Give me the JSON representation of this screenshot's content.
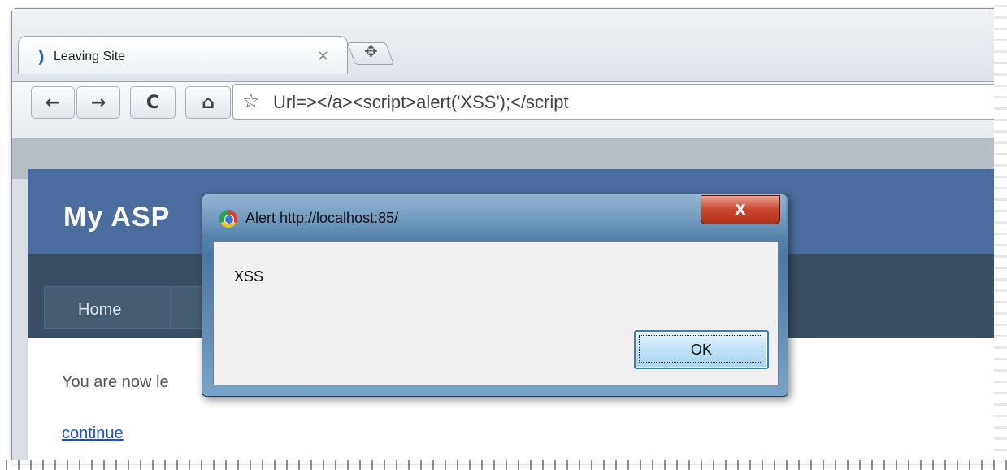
{
  "browser": {
    "tab": {
      "title": "Leaving Site",
      "close_glyph": "×"
    },
    "new_tab_glyph": "✥",
    "toolbar": {
      "back_glyph": "←",
      "forward_glyph": "→",
      "reload_glyph": "C",
      "home_glyph": "⌂",
      "bookmark_glyph": "☆",
      "address": "Url=></a><script>alert('XSS');</script"
    }
  },
  "site": {
    "title": "My ASP",
    "menu": [
      {
        "label": "Home"
      }
    ],
    "body_text": "You are now le",
    "link_text": "continue"
  },
  "dialog": {
    "title": "Alert http://localhost:85/",
    "close_glyph": "X",
    "message": "XSS",
    "ok_label": "OK"
  },
  "colors": {
    "site_header": "#4b6c9e",
    "site_menu": "#3a4f63",
    "link": "#1a4fd6"
  }
}
